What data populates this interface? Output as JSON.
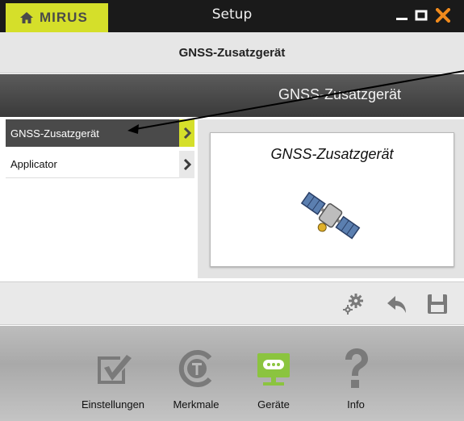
{
  "titlebar": {
    "brand": "MIRUS",
    "title": "Setup",
    "icons": {
      "home": "home-icon",
      "minimize": "minimize-icon",
      "maximize": "maximize-icon",
      "close": "close-icon"
    }
  },
  "breadcrumb": {
    "text": "GNSS-Zusatzgerät"
  },
  "header": {
    "title": "GNSS-Zusatzgerät"
  },
  "device_list": {
    "items": [
      {
        "label": "GNSS-Zusatzgerät",
        "selected": true
      },
      {
        "label": "Applicator",
        "selected": false
      }
    ]
  },
  "detail": {
    "title": "GNSS-Zusatzgerät",
    "image_icon": "satellite-icon"
  },
  "toolbar": {
    "icons": [
      "settings-gears-icon",
      "undo-arrow-icon",
      "save-floppy-icon"
    ]
  },
  "bottom_nav": {
    "items": [
      {
        "label": "Einstellungen",
        "icon": "checkbox-pencil-icon",
        "active": false
      },
      {
        "label": "Merkmale",
        "icon": "features-t-icon",
        "active": false
      },
      {
        "label": "Geräte",
        "icon": "device-monitor-icon",
        "active": true
      },
      {
        "label": "Info",
        "icon": "question-mark-icon",
        "active": false
      }
    ]
  },
  "colors": {
    "accent": "#d5df2a",
    "active_green": "#8bc43f",
    "close_orange": "#f08a1c",
    "dark_item": "#4a4a4a",
    "icon_gray": "#7a7a7a"
  }
}
